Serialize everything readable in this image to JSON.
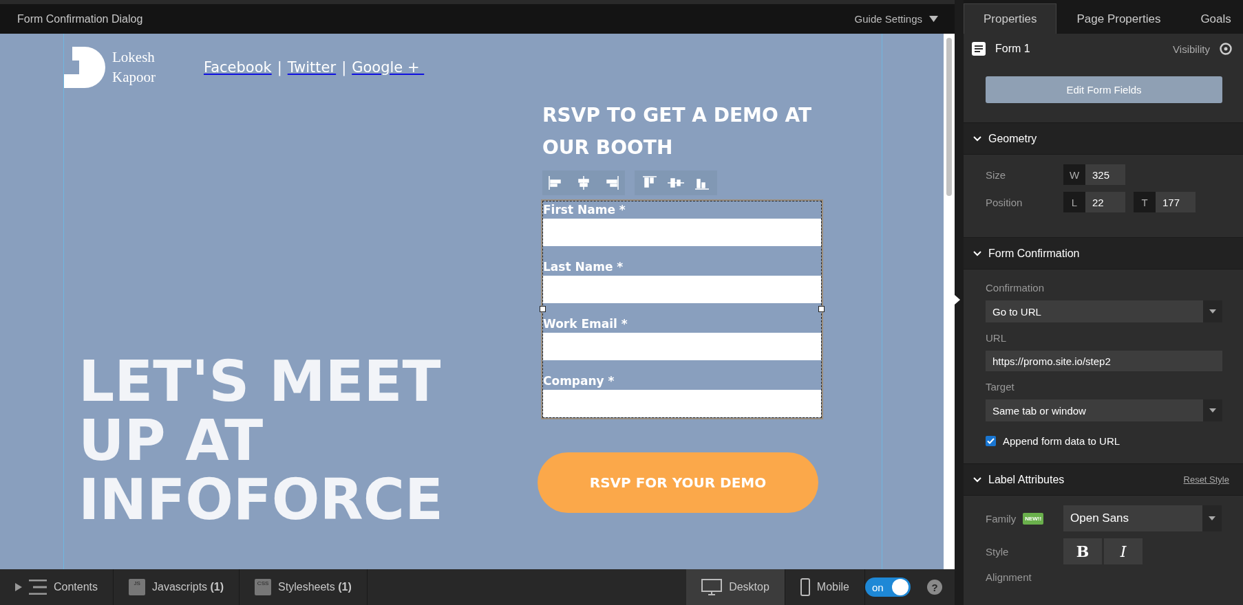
{
  "top_bar": {
    "title": "Form Confirmation Dialog",
    "guide_settings": "Guide Settings"
  },
  "canvas": {
    "logo": {
      "line_1": "Lokesh",
      "line_2": "Kapoor"
    },
    "social_links": [
      "Facebook",
      "Twitter",
      "Google + "
    ],
    "link_separators": [
      "|",
      "|"
    ],
    "hero_heading": [
      "LET'S MEET",
      "UP AT",
      "INFOFORCE"
    ],
    "rsvp_heading": "RSVP TO GET A DEMO AT OUR BOOTH",
    "form_fields": [
      {
        "label": "First Name *"
      },
      {
        "label": "Last Name *"
      },
      {
        "label": "Work Email *"
      },
      {
        "label": "Company *"
      }
    ],
    "submit_button": "RSVP FOR YOUR DEMO"
  },
  "properties_panel": {
    "tabs": [
      {
        "label": "Properties",
        "selected": true
      },
      {
        "label": "Page Properties",
        "selected": false
      },
      {
        "label": "Goals",
        "selected": false
      }
    ],
    "element_name": "Form 1",
    "visibility": "Visibility",
    "edit_button": "Edit Form Fields",
    "geometry": {
      "title": "Geometry",
      "expanded": true,
      "size_label": "Size",
      "position_label": "Position",
      "width": {
        "key": "W",
        "value": "325"
      },
      "left": {
        "key": "L",
        "value": "22"
      },
      "top": {
        "key": "T",
        "value": "177"
      }
    },
    "form_confirmation": {
      "title": "Form Confirmation",
      "expanded": true,
      "confirmation_label": "Confirmation",
      "confirmation_value": "Go to URL",
      "url_label": "URL",
      "url_value": "https://promo.site.io/step2",
      "target_label": "Target",
      "target_value": "Same tab or window",
      "append_label": "Append form data to URL",
      "append_checked": true
    },
    "label_attributes": {
      "title": "Label Attributes",
      "expanded": true,
      "reset": "Reset Style",
      "family_label": "Family",
      "new_badge": "NEW!!",
      "family_value": "Open Sans",
      "style_label": "Style",
      "bold_key": "B",
      "italic_key": "I",
      "alignment_label": "Alignment"
    }
  },
  "bottom_bar": {
    "contents": "Contents",
    "scripts": {
      "badge": "JS",
      "label": "Javascripts",
      "count": "(1)"
    },
    "styles": {
      "badge": "CSS",
      "label": "Stylesheets",
      "count": "(1)"
    },
    "devices": [
      {
        "label": "Desktop",
        "kind": "desktop",
        "selected": true
      },
      {
        "label": "Mobile",
        "kind": "mobile",
        "selected": false
      }
    ],
    "toggle": {
      "label": "on",
      "on": true
    },
    "help": "?"
  }
}
